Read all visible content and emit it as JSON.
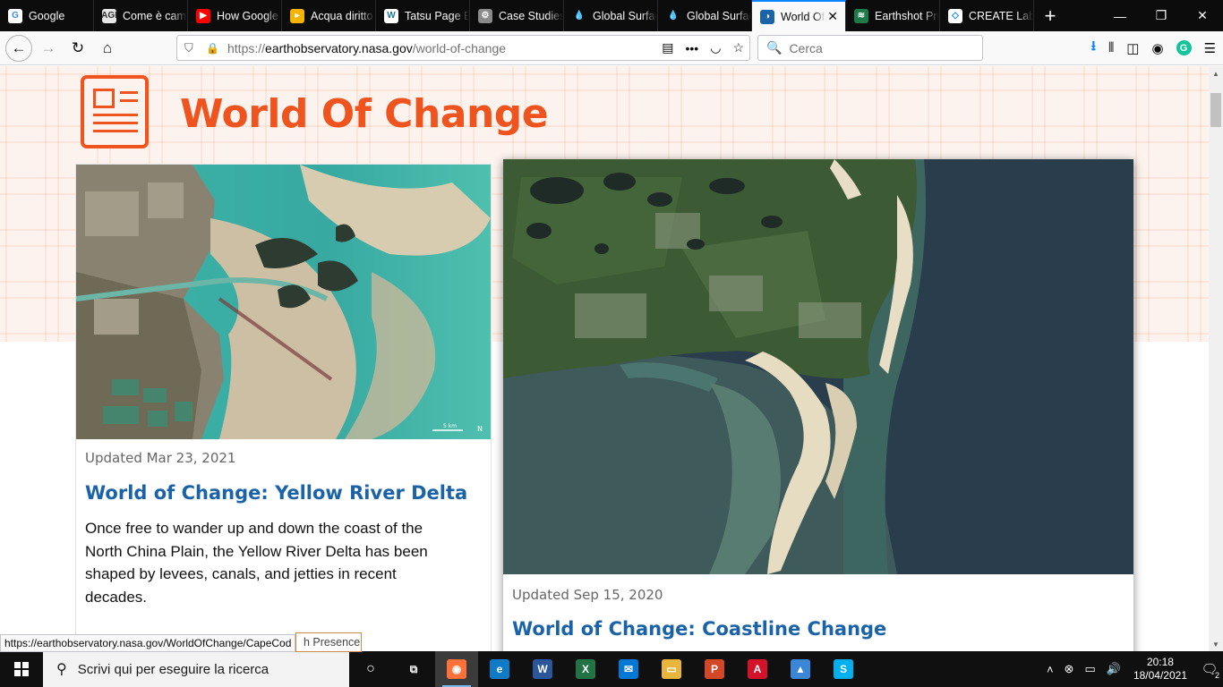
{
  "browser": {
    "tabs": [
      {
        "title": "Google",
        "icon": "google-icon",
        "color": "#ffffff",
        "glyph": "G",
        "glyph_color": "#4285f4"
      },
      {
        "title": "Come è cambiato",
        "icon": "agi-icon",
        "color": "#e6e6e6",
        "glyph": "AGI",
        "glyph_color": "#333333"
      },
      {
        "title": "How Google Earth",
        "icon": "youtube-icon",
        "color": "#ff0000",
        "glyph": "▶",
        "glyph_color": "#ffffff"
      },
      {
        "title": "Acqua diritto",
        "icon": "slides-icon",
        "color": "#f4b400",
        "glyph": "▸",
        "glyph_color": "#ffffff"
      },
      {
        "title": "Tatsu Page Builder",
        "icon": "wordpress-icon",
        "color": "#ffffff",
        "glyph": "W",
        "glyph_color": "#21759b"
      },
      {
        "title": "Case Studies",
        "icon": "gear-icon",
        "color": "#8a8a8a",
        "glyph": "⚙",
        "glyph_color": "#ffffff"
      },
      {
        "title": "Global Surface",
        "icon": "water-drop-icon",
        "color": "#0c0c0d",
        "glyph": "💧",
        "glyph_color": "#3aa0ff"
      },
      {
        "title": "Global Surface",
        "icon": "water-drop-icon",
        "color": "#0c0c0d",
        "glyph": "💧",
        "glyph_color": "#3aa0ff"
      },
      {
        "title": "World Of Change",
        "icon": "nasa-icon",
        "color": "#1b63a8",
        "glyph": "◑",
        "glyph_color": "#ffffff",
        "active": true
      },
      {
        "title": "Earthshot Prize",
        "icon": "earthshot-icon",
        "color": "#1e7a4a",
        "glyph": "≋",
        "glyph_color": "#ffffff"
      },
      {
        "title": "CREATE Lab",
        "icon": "create-lab-icon",
        "color": "#ffffff",
        "glyph": "◇",
        "glyph_color": "#0a84ff"
      }
    ],
    "url_prefix": "https://",
    "url_domain": "earthobservatory.nasa.gov",
    "url_path": "/world-of-change",
    "search_placeholder": "Cerca",
    "status_url": "https://earthobservatory.nasa.gov/WorldOfChange/CapeCod"
  },
  "page": {
    "title": "World Of Change",
    "cards": [
      {
        "updated": "Updated Mar 23, 2021",
        "title": "World of Change: Yellow River Delta",
        "description": "Once free to wander up and down the coast of the North China Plain, the Yellow River Delta has been shaped by levees, canals, and jetties in recent decades.",
        "scale": "5 km",
        "north": "N"
      },
      {
        "updated": "Updated Sep 15, 2020",
        "title": "World of Change: Coastline Change"
      }
    ],
    "partial_button": "h Presence"
  },
  "taskbar": {
    "search_placeholder": "Scrivi qui per eseguire la ricerca",
    "apps": [
      {
        "name": "task-view",
        "glyph": "⧉",
        "color": "#101010"
      },
      {
        "name": "firefox",
        "glyph": "◉",
        "color": "#ff7139",
        "active": true
      },
      {
        "name": "edge",
        "glyph": "e",
        "color": "#0f7ac6"
      },
      {
        "name": "word",
        "glyph": "W",
        "color": "#2b579a"
      },
      {
        "name": "excel",
        "glyph": "X",
        "color": "#217346"
      },
      {
        "name": "mail",
        "glyph": "✉",
        "color": "#0078d4"
      },
      {
        "name": "file-explorer",
        "glyph": "▭",
        "color": "#e8b63a"
      },
      {
        "name": "powerpoint",
        "glyph": "P",
        "color": "#d24726"
      },
      {
        "name": "acrobat",
        "glyph": "A",
        "color": "#d4122b"
      },
      {
        "name": "photos",
        "glyph": "▲",
        "color": "#3a86d8"
      },
      {
        "name": "skype",
        "glyph": "S",
        "color": "#00aff0"
      }
    ],
    "time": "20:18",
    "date": "18/04/2021",
    "notifications": "2"
  },
  "colors": {
    "accent": "#f0541e",
    "link": "#1b63a8",
    "tab_active_border": "#0a84ff"
  }
}
